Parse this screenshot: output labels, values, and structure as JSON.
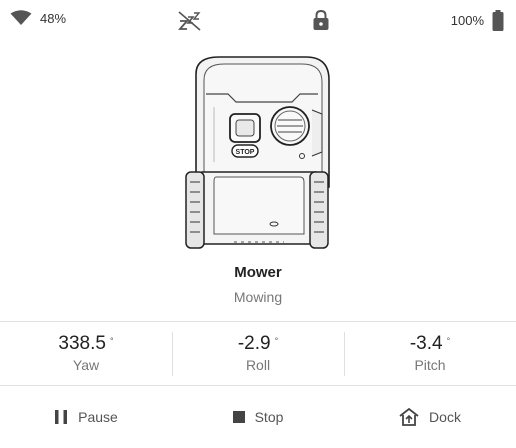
{
  "status_bar": {
    "wifi_signal": "48%",
    "battery": "100%",
    "icons": [
      "wifi-icon",
      "sleep-icon",
      "lock-icon",
      "battery-icon"
    ]
  },
  "device": {
    "name": "Mower",
    "status": "Mowing"
  },
  "metrics": [
    {
      "value": "338.5",
      "unit": "°",
      "label": "Yaw"
    },
    {
      "value": "-2.9",
      "unit": "°",
      "label": "Roll"
    },
    {
      "value": "-3.4",
      "unit": "°",
      "label": "Pitch"
    }
  ],
  "actions": {
    "pause": "Pause",
    "stop": "Stop",
    "dock": "Dock"
  },
  "robot_labels": {
    "stop_button": "STOP"
  },
  "colors": {
    "text": "#212121",
    "muted": "#777777",
    "divider": "#e0e0e0"
  }
}
